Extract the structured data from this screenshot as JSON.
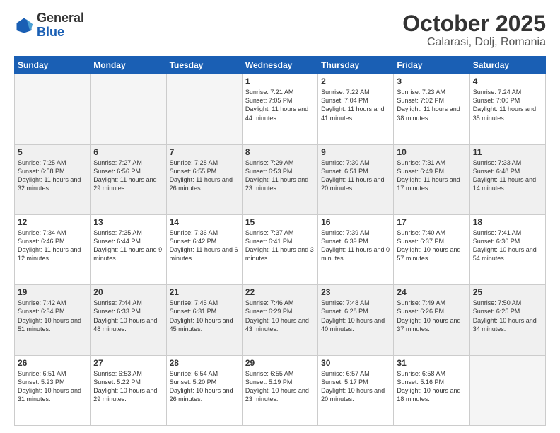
{
  "header": {
    "logo_general": "General",
    "logo_blue": "Blue",
    "title": "October 2025",
    "subtitle": "Calarasi, Dolj, Romania"
  },
  "weekdays": [
    "Sunday",
    "Monday",
    "Tuesday",
    "Wednesday",
    "Thursday",
    "Friday",
    "Saturday"
  ],
  "rows": [
    [
      {
        "day": "",
        "sunrise": "",
        "sunset": "",
        "daylight": "",
        "empty": true
      },
      {
        "day": "",
        "sunrise": "",
        "sunset": "",
        "daylight": "",
        "empty": true
      },
      {
        "day": "",
        "sunrise": "",
        "sunset": "",
        "daylight": "",
        "empty": true
      },
      {
        "day": "1",
        "sunrise": "Sunrise: 7:21 AM",
        "sunset": "Sunset: 7:05 PM",
        "daylight": "Daylight: 11 hours and 44 minutes."
      },
      {
        "day": "2",
        "sunrise": "Sunrise: 7:22 AM",
        "sunset": "Sunset: 7:04 PM",
        "daylight": "Daylight: 11 hours and 41 minutes."
      },
      {
        "day": "3",
        "sunrise": "Sunrise: 7:23 AM",
        "sunset": "Sunset: 7:02 PM",
        "daylight": "Daylight: 11 hours and 38 minutes."
      },
      {
        "day": "4",
        "sunrise": "Sunrise: 7:24 AM",
        "sunset": "Sunset: 7:00 PM",
        "daylight": "Daylight: 11 hours and 35 minutes."
      }
    ],
    [
      {
        "day": "5",
        "sunrise": "Sunrise: 7:25 AM",
        "sunset": "Sunset: 6:58 PM",
        "daylight": "Daylight: 11 hours and 32 minutes."
      },
      {
        "day": "6",
        "sunrise": "Sunrise: 7:27 AM",
        "sunset": "Sunset: 6:56 PM",
        "daylight": "Daylight: 11 hours and 29 minutes."
      },
      {
        "day": "7",
        "sunrise": "Sunrise: 7:28 AM",
        "sunset": "Sunset: 6:55 PM",
        "daylight": "Daylight: 11 hours and 26 minutes."
      },
      {
        "day": "8",
        "sunrise": "Sunrise: 7:29 AM",
        "sunset": "Sunset: 6:53 PM",
        "daylight": "Daylight: 11 hours and 23 minutes."
      },
      {
        "day": "9",
        "sunrise": "Sunrise: 7:30 AM",
        "sunset": "Sunset: 6:51 PM",
        "daylight": "Daylight: 11 hours and 20 minutes."
      },
      {
        "day": "10",
        "sunrise": "Sunrise: 7:31 AM",
        "sunset": "Sunset: 6:49 PM",
        "daylight": "Daylight: 11 hours and 17 minutes."
      },
      {
        "day": "11",
        "sunrise": "Sunrise: 7:33 AM",
        "sunset": "Sunset: 6:48 PM",
        "daylight": "Daylight: 11 hours and 14 minutes."
      }
    ],
    [
      {
        "day": "12",
        "sunrise": "Sunrise: 7:34 AM",
        "sunset": "Sunset: 6:46 PM",
        "daylight": "Daylight: 11 hours and 12 minutes."
      },
      {
        "day": "13",
        "sunrise": "Sunrise: 7:35 AM",
        "sunset": "Sunset: 6:44 PM",
        "daylight": "Daylight: 11 hours and 9 minutes."
      },
      {
        "day": "14",
        "sunrise": "Sunrise: 7:36 AM",
        "sunset": "Sunset: 6:42 PM",
        "daylight": "Daylight: 11 hours and 6 minutes."
      },
      {
        "day": "15",
        "sunrise": "Sunrise: 7:37 AM",
        "sunset": "Sunset: 6:41 PM",
        "daylight": "Daylight: 11 hours and 3 minutes."
      },
      {
        "day": "16",
        "sunrise": "Sunrise: 7:39 AM",
        "sunset": "Sunset: 6:39 PM",
        "daylight": "Daylight: 11 hours and 0 minutes."
      },
      {
        "day": "17",
        "sunrise": "Sunrise: 7:40 AM",
        "sunset": "Sunset: 6:37 PM",
        "daylight": "Daylight: 10 hours and 57 minutes."
      },
      {
        "day": "18",
        "sunrise": "Sunrise: 7:41 AM",
        "sunset": "Sunset: 6:36 PM",
        "daylight": "Daylight: 10 hours and 54 minutes."
      }
    ],
    [
      {
        "day": "19",
        "sunrise": "Sunrise: 7:42 AM",
        "sunset": "Sunset: 6:34 PM",
        "daylight": "Daylight: 10 hours and 51 minutes."
      },
      {
        "day": "20",
        "sunrise": "Sunrise: 7:44 AM",
        "sunset": "Sunset: 6:33 PM",
        "daylight": "Daylight: 10 hours and 48 minutes."
      },
      {
        "day": "21",
        "sunrise": "Sunrise: 7:45 AM",
        "sunset": "Sunset: 6:31 PM",
        "daylight": "Daylight: 10 hours and 45 minutes."
      },
      {
        "day": "22",
        "sunrise": "Sunrise: 7:46 AM",
        "sunset": "Sunset: 6:29 PM",
        "daylight": "Daylight: 10 hours and 43 minutes."
      },
      {
        "day": "23",
        "sunrise": "Sunrise: 7:48 AM",
        "sunset": "Sunset: 6:28 PM",
        "daylight": "Daylight: 10 hours and 40 minutes."
      },
      {
        "day": "24",
        "sunrise": "Sunrise: 7:49 AM",
        "sunset": "Sunset: 6:26 PM",
        "daylight": "Daylight: 10 hours and 37 minutes."
      },
      {
        "day": "25",
        "sunrise": "Sunrise: 7:50 AM",
        "sunset": "Sunset: 6:25 PM",
        "daylight": "Daylight: 10 hours and 34 minutes."
      }
    ],
    [
      {
        "day": "26",
        "sunrise": "Sunrise: 6:51 AM",
        "sunset": "Sunset: 5:23 PM",
        "daylight": "Daylight: 10 hours and 31 minutes."
      },
      {
        "day": "27",
        "sunrise": "Sunrise: 6:53 AM",
        "sunset": "Sunset: 5:22 PM",
        "daylight": "Daylight: 10 hours and 29 minutes."
      },
      {
        "day": "28",
        "sunrise": "Sunrise: 6:54 AM",
        "sunset": "Sunset: 5:20 PM",
        "daylight": "Daylight: 10 hours and 26 minutes."
      },
      {
        "day": "29",
        "sunrise": "Sunrise: 6:55 AM",
        "sunset": "Sunset: 5:19 PM",
        "daylight": "Daylight: 10 hours and 23 minutes."
      },
      {
        "day": "30",
        "sunrise": "Sunrise: 6:57 AM",
        "sunset": "Sunset: 5:17 PM",
        "daylight": "Daylight: 10 hours and 20 minutes."
      },
      {
        "day": "31",
        "sunrise": "Sunrise: 6:58 AM",
        "sunset": "Sunset: 5:16 PM",
        "daylight": "Daylight: 10 hours and 18 minutes."
      },
      {
        "day": "",
        "sunrise": "",
        "sunset": "",
        "daylight": "",
        "empty": true
      }
    ]
  ]
}
